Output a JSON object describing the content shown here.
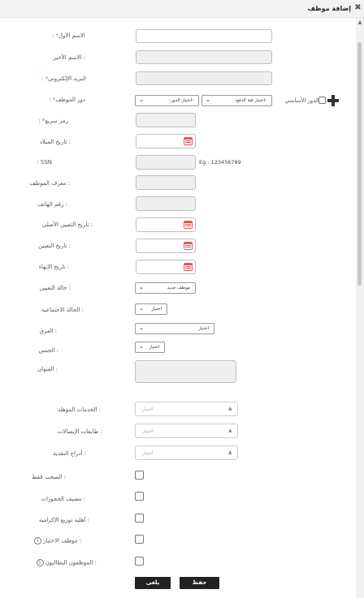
{
  "dialog": {
    "title": "إضافة موظف",
    "close_icon": "close-icon"
  },
  "labels": {
    "first_name": "الاسم الأول",
    "last_name": ": الاسم الأخير",
    "email": "البريد الإلكتروني",
    "role": "دور الموظف",
    "quick_code": "رمز سريع",
    "birth_date": ": تاريخ الميلاد",
    "ssn": "SSN :",
    "employee_id": ": معرف الموظف",
    "phone": ": رقم الهاتف",
    "original_hire_date": ": تاريخ التعيين الأصلي",
    "hire_date": ": تاريخ التعيين",
    "termination_date": ": تاريخ الإنهاء",
    "hire_status": ": حالة التعيين",
    "marital_status": ": الحالة الاجتماعية",
    "race": ": العرق",
    "gender": ": الجنس",
    "address": ": العنوان",
    "qualified_services": ": الخدمات المؤهلة",
    "connection_printers": ": طابعات الإيصالات",
    "cash_drawers": ": أدراج النقدية",
    "withdraw_only": ": السحب فقط",
    "reservations_host": ": مضيف الحجوزات",
    "tip_eligibility": ": أهلية توزيع الإكرامية",
    "test_employee": ": موظف الاختبار",
    "unemployed_employees": ": الموظفون البطاليون"
  },
  "required_mark": "*",
  "colon": ":",
  "role_select": {
    "category_value": "-اختيار فئة الدفع-",
    "role_value": "-اختيار الدور-",
    "primary_role_label": "الدور الأساسي"
  },
  "ssn_example": "Eg : 123456789",
  "hire_status_value": "موظف جديد",
  "marital_status_value": "اختيار",
  "race_value": "اختيار",
  "gender_value": "اختيار",
  "multiselect_placeholder": "اختيار",
  "info_glyph": "i",
  "buttons": {
    "save": "حفظ",
    "cancel": "يلغى"
  }
}
